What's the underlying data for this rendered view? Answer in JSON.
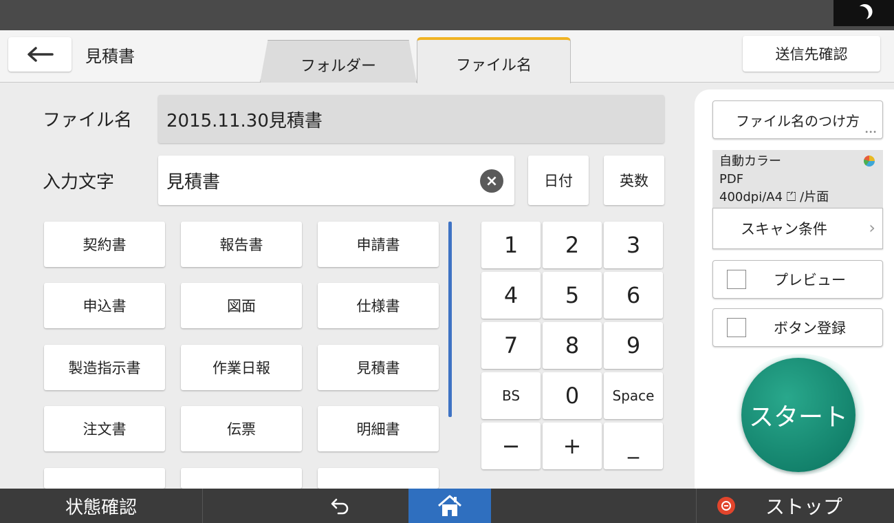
{
  "header": {
    "title": "見積書",
    "tabs": [
      {
        "label": "フォルダー",
        "active": false
      },
      {
        "label": "ファイル名",
        "active": true
      }
    ],
    "destination_button": "送信先確認",
    "active_tab_color": "#f0b323"
  },
  "form": {
    "filename_label": "ファイル名",
    "filename_value": "2015.11.30見積書",
    "input_label": "入力文字",
    "input_value": "見積書",
    "date_button": "日付",
    "alnum_button": "英数"
  },
  "presets": {
    "rows": [
      [
        "契約書",
        "報告書",
        "申請書"
      ],
      [
        "申込書",
        "図面",
        "仕様書"
      ],
      [
        "製造指示書",
        "作業日報",
        "見積書"
      ],
      [
        "注文書",
        "伝票",
        "明細書"
      ]
    ]
  },
  "keypad": {
    "rows": [
      [
        "1",
        "2",
        "3"
      ],
      [
        "4",
        "5",
        "6"
      ],
      [
        "7",
        "8",
        "9"
      ],
      [
        "BS",
        "0",
        "Space"
      ],
      [
        "−",
        "+",
        "_"
      ]
    ]
  },
  "side": {
    "naming_button": "ファイル名のつけ方",
    "scan_summary": {
      "color": "自動カラー",
      "format": "PDF",
      "resolution": "400dpi/A4 ⏍ /片面"
    },
    "scan_settings_button": "スキャン条件",
    "preview_label": "プレビュー",
    "register_label": "ボタン登録",
    "start_label": "スタート",
    "start_color": "#12806a"
  },
  "bottombar": {
    "status_label": "状態確認",
    "stop_label": "ストップ",
    "home_color": "#2f6fbf",
    "stop_color": "#e2452c"
  }
}
